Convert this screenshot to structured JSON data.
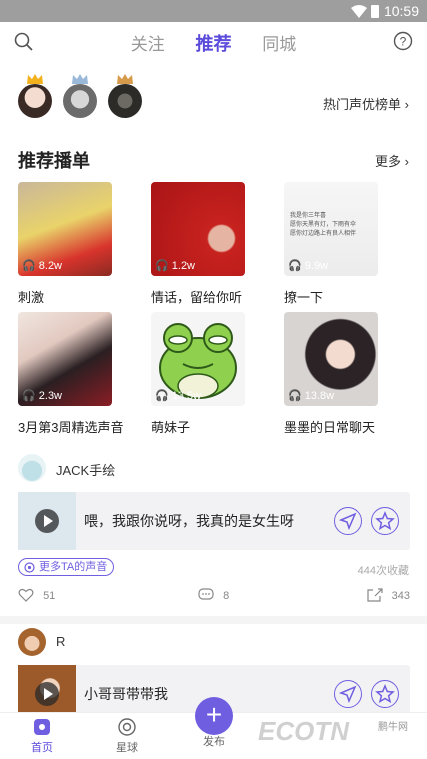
{
  "status": {
    "time": "10:59"
  },
  "topnav": {
    "tabs": [
      "关注",
      "推荐",
      "同城"
    ],
    "active_tab": "推荐"
  },
  "ranking": {
    "link_label": "热门声优榜单"
  },
  "playlist_section": {
    "title": "推荐播单",
    "more_label": "更多",
    "cards": [
      {
        "title": "刺激",
        "plays": "8.2w"
      },
      {
        "title": "情话，留给你听",
        "plays": "1.2w"
      },
      {
        "title": "撩一下",
        "plays": "9.9w",
        "cover_text": "我是你三年喜\n愿你天黑有灯，下雨有伞\n愿你灯边路上有良人相伴"
      },
      {
        "title": "3月第3周精选声音",
        "plays": "2.3w"
      },
      {
        "title": "萌妹子",
        "plays": "13.5w"
      },
      {
        "title": "墨墨的日常聊天",
        "plays": "13.8w"
      }
    ]
  },
  "feed": [
    {
      "user": "JACK手绘",
      "text": "喂，我跟你说呀，我真的是女生呀",
      "more_voices_label": "更多TA的声音",
      "favs": "444次收藏",
      "likes": "51",
      "comments": "8",
      "shares": "343"
    },
    {
      "user": "R",
      "text": "小哥哥带带我"
    }
  ],
  "bottom_nav": {
    "items": [
      "首页",
      "星球",
      "发布"
    ],
    "active": "首页"
  },
  "watermark": {
    "logo": "ECOTN",
    "sub": "鹏牛网"
  },
  "colors": {
    "accent": "#5b4bdb",
    "accent_light": "#6f5fe0"
  }
}
